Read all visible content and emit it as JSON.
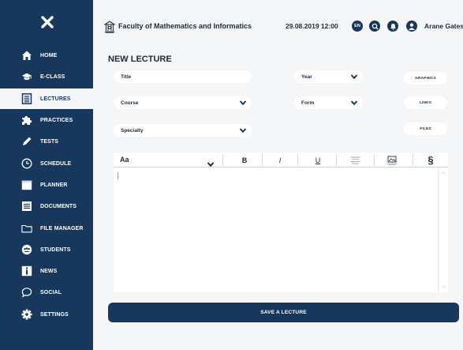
{
  "app": {
    "title": "Faculty of Mathematics and Informatics",
    "datetime": "29.08.2019  12:00",
    "language_badge": "EN",
    "user_name": "Arane Gates",
    "colors": {
      "primary": "#17385c",
      "background": "#f5f6f8",
      "field": "#ffffff"
    }
  },
  "sidebar": {
    "close_icon": "close-icon",
    "items": [
      {
        "label": "HOME",
        "icon": "home-icon",
        "active": false
      },
      {
        "label": "E-CLASS",
        "icon": "graduation-cap-icon",
        "active": false
      },
      {
        "label": "LECTURES",
        "icon": "document-lines-icon",
        "active": true
      },
      {
        "label": "PRACTICES",
        "icon": "puzzle-icon",
        "active": false
      },
      {
        "label": "TESTS",
        "icon": "pencil-icon",
        "active": false
      },
      {
        "label": "SCHEDULE",
        "icon": "clock-icon",
        "active": false
      },
      {
        "label": "PLANNER",
        "icon": "calendar-icon",
        "active": false
      },
      {
        "label": "DOCUMENTS",
        "icon": "documents-icon",
        "active": false
      },
      {
        "label": "FILE MANAGER",
        "icon": "folder-icon",
        "active": false
      },
      {
        "label": "STUDENTS",
        "icon": "students-icon",
        "active": false
      },
      {
        "label": "NEWS",
        "icon": "info-icon",
        "active": false
      },
      {
        "label": "SOCIAL",
        "icon": "chat-icon",
        "active": false
      },
      {
        "label": "SETTINGS",
        "icon": "gear-icon",
        "active": false
      }
    ]
  },
  "main": {
    "page_title": "NEW LECTURE",
    "fields": {
      "title": "Title",
      "course": "Course",
      "specialty": "Specialty",
      "year": "Year",
      "form": "Form"
    },
    "side_buttons": {
      "graphics": "GRAPHICS",
      "links": "LINKS",
      "files": "FILES"
    },
    "editor": {
      "font_label": "Aa",
      "bold": "B",
      "italic": "I",
      "underline": "U",
      "align_icon": "align-center-icon",
      "image_icon": "image-icon",
      "section_symbol": "§",
      "content": ""
    },
    "save_button": "SAVE A LECTURE"
  }
}
